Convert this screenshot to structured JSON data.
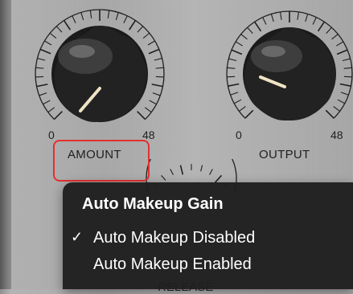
{
  "amount_knob": {
    "name": "AMOUNT",
    "min_label": "0",
    "max_label": "48"
  },
  "output_knob": {
    "name": "OUTPUT",
    "min_label": "0",
    "max_label": "48"
  },
  "release_knob": {
    "name": "RELEASE"
  },
  "context_menu": {
    "title": "Auto Makeup Gain",
    "items": [
      {
        "label": "Auto Makeup Disabled",
        "checked": true,
        "check_mark": "✓"
      },
      {
        "label": "Auto Makeup Enabled",
        "checked": false,
        "check_mark": ""
      }
    ]
  },
  "colors": {
    "highlight": "#e3302f",
    "menu_bg": "#1e1e1e",
    "panel": "#b0b0b0"
  }
}
